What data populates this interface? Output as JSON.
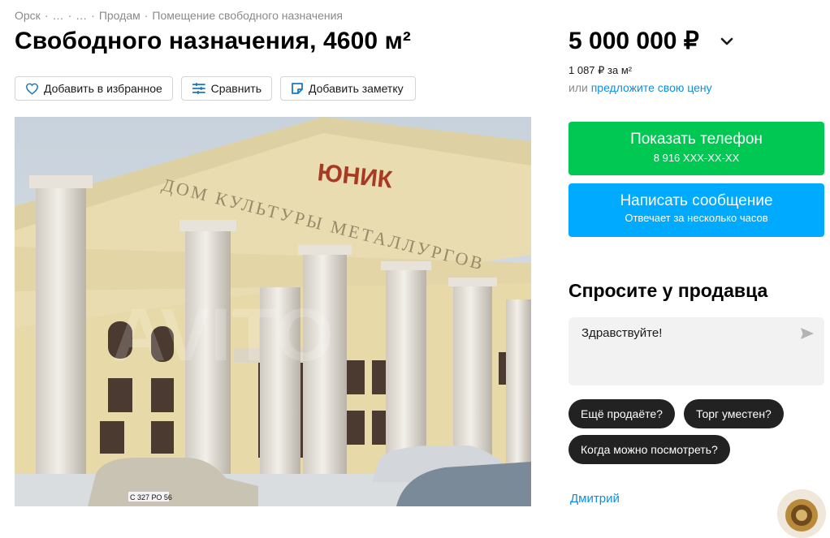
{
  "breadcrumb": {
    "items": [
      "Орск",
      "…",
      "…",
      "Продам",
      "Помещение свободного назначения"
    ],
    "separator": "·"
  },
  "title": "Свободного назначения, 4600 м²",
  "actions": {
    "favorite_label": "Добавить в избранное",
    "compare_label": "Сравнить",
    "note_label": "Добавить заметку"
  },
  "photo": {
    "sign_text": "ЮНИК",
    "facade_text": "ДОМ КУЛЬТУРЫ МЕТАЛЛУРГОВ",
    "plate_text": "С 327 РО 56",
    "watermark_text": "AVITO"
  },
  "pricing": {
    "price": "5 000 000 ₽",
    "per_m2": "1 087 ₽ за м²",
    "offer_prefix": "или",
    "offer_link": "предложите свою цену"
  },
  "phone_button": {
    "label": "Показать телефон",
    "number": "8 916 XXX-XX-XX",
    "color": "#00c853"
  },
  "message_button": {
    "label": "Написать сообщение",
    "subtitle": "Отвечает за несколько часов",
    "color": "#00aaff"
  },
  "ask": {
    "title": "Спросите у продавца",
    "input_value": "Здравствуйте!",
    "chips": [
      "Ещё продаёте?",
      "Торг уместен?",
      "Когда можно посмотреть?"
    ]
  },
  "seller": {
    "name": "Дмитрий"
  },
  "icons": {
    "favorite": "heart-icon",
    "compare": "compare-icon",
    "note": "note-icon",
    "price_toggle": "chevron-down-icon",
    "send": "send-icon"
  }
}
